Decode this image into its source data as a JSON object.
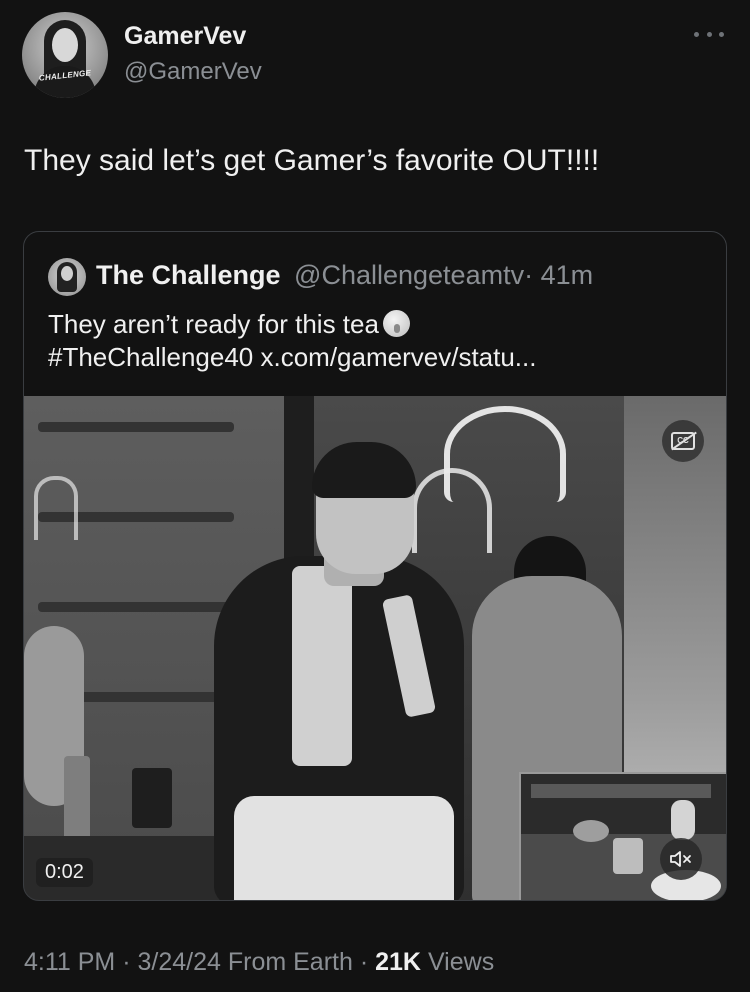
{
  "author": {
    "display_name": "GamerVev",
    "handle": "@GamerVev",
    "avatar_logo_text": "CHALLENGE"
  },
  "tweet": {
    "text": "They said let’s get Gamer’s favorite OUT!!!!"
  },
  "quoted_tweet": {
    "display_name": "The Challenge",
    "handle": "@Challengeteamtv",
    "age": "· 41m",
    "line1": "They aren’t ready for this tea",
    "emoji": "shushing-face",
    "line2": "#TheChallenge40 x.com/gamervev/statu...",
    "video": {
      "elapsed": "0:02",
      "captions_icon": "captions-off-icon",
      "volume_icon": "speaker-muted-icon"
    }
  },
  "footer": {
    "time": "4:11 PM",
    "date": "3/24/24",
    "source": "From Earth",
    "views_count": "21K",
    "views_label": "Views"
  },
  "colors": {
    "background": "#121212",
    "text_primary": "#f0f0f0",
    "text_secondary": "#8b8f94",
    "border": "#3a3d41"
  }
}
